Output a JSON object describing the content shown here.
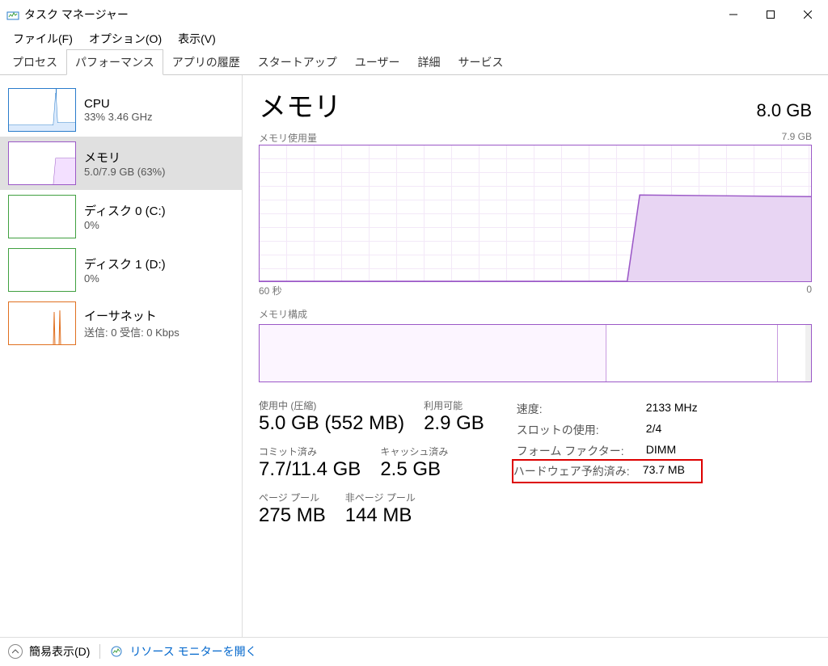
{
  "window": {
    "title": "タスク マネージャー"
  },
  "menu": {
    "file": "ファイル(F)",
    "options": "オプション(O)",
    "view": "表示(V)"
  },
  "tabs": {
    "processes": "プロセス",
    "performance": "パフォーマンス",
    "app_history": "アプリの履歴",
    "startup": "スタートアップ",
    "users": "ユーザー",
    "details": "詳細",
    "services": "サービス"
  },
  "sidebar": {
    "cpu": {
      "name": "CPU",
      "detail": "33%  3.46 GHz"
    },
    "memory": {
      "name": "メモリ",
      "detail": "5.0/7.9 GB (63%)"
    },
    "disk0": {
      "name": "ディスク 0 (C:)",
      "detail": "0%"
    },
    "disk1": {
      "name": "ディスク 1 (D:)",
      "detail": "0%"
    },
    "ethernet": {
      "name": "イーサネット",
      "detail": "送信: 0 受信: 0 Kbps"
    }
  },
  "memory_page": {
    "title": "メモリ",
    "total": "8.0 GB",
    "usage_label": "メモリ使用量",
    "usage_max": "7.9 GB",
    "x_left": "60 秒",
    "x_right": "0",
    "composition_label": "メモリ構成",
    "stats": {
      "in_use_label": "使用中 (圧縮)",
      "in_use_value": "5.0 GB (552 MB)",
      "available_label": "利用可能",
      "available_value": "2.9 GB",
      "committed_label": "コミット済み",
      "committed_value": "7.7/11.4 GB",
      "cached_label": "キャッシュ済み",
      "cached_value": "2.5 GB",
      "paged_label": "ページ プール",
      "paged_value": "275 MB",
      "nonpaged_label": "非ページ プール",
      "nonpaged_value": "144 MB"
    },
    "props": {
      "speed_k": "速度:",
      "speed_v": "2133 MHz",
      "slots_k": "スロットの使用:",
      "slots_v": "2/4",
      "form_k": "フォーム ファクター:",
      "form_v": "DIMM",
      "hw_k": "ハードウェア予約済み:",
      "hw_v": "73.7 MB"
    }
  },
  "footer": {
    "fewer": "簡易表示(D)",
    "resmon": "リソース モニターを開く"
  },
  "chart_data": {
    "type": "line",
    "title": "メモリ使用量",
    "ylabel": "GB",
    "ylim": [
      0,
      7.9
    ],
    "xlabel": "秒",
    "xlim": [
      60,
      0
    ],
    "x": [
      60,
      42,
      40,
      0
    ],
    "y": [
      0,
      0,
      5.0,
      5.0
    ]
  }
}
